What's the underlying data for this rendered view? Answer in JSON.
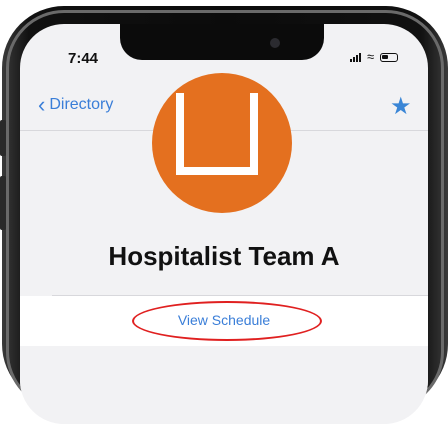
{
  "status_bar": {
    "time": "7:44"
  },
  "nav": {
    "back_label": "Directory"
  },
  "profile": {
    "name": "Hospitalist Team A"
  },
  "actions": {
    "view_schedule_label": "View Schedule"
  },
  "colors": {
    "accent": "#3a7ed8",
    "avatar": "#e4701f",
    "highlight": "#e02020"
  }
}
